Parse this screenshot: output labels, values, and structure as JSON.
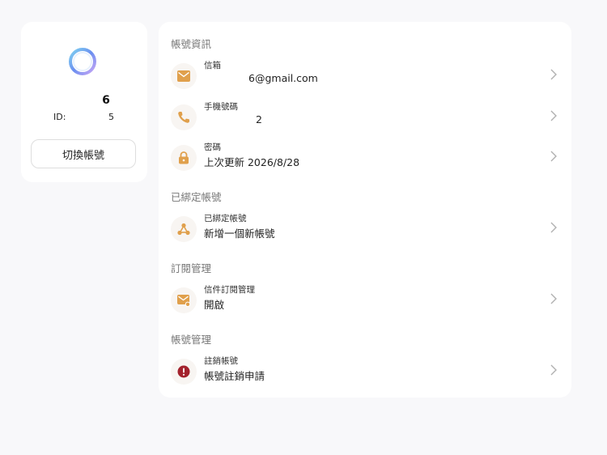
{
  "profile": {
    "name": "6",
    "id_label": "ID:",
    "id_value": "5",
    "switch_label": "切換帳號"
  },
  "colors": {
    "accent": "#e0a04c",
    "danger": "#a3222d",
    "chevron": "#b0b0b0"
  },
  "sections": {
    "account_info": {
      "title": "帳號資訊",
      "email": {
        "label": "信箱",
        "value": "6@gmail.com",
        "icon": "mail-icon"
      },
      "phone": {
        "label": "手機號碼",
        "value": "2",
        "icon": "phone-icon"
      },
      "password": {
        "label": "密碼",
        "value": "上次更新 2026/8/28",
        "icon": "lock-icon"
      }
    },
    "linked_accounts": {
      "title": "已綁定帳號",
      "linked": {
        "label": "已綁定帳號",
        "value": "新增一個新帳號",
        "icon": "share-nodes-icon"
      }
    },
    "subscription": {
      "title": "訂閱管理",
      "mail_sub": {
        "label": "信件訂閱管理",
        "value": "開啟",
        "icon": "mail-settings-icon"
      }
    },
    "account_management": {
      "title": "帳號管理",
      "delete": {
        "label": "註銷帳號",
        "value": "帳號註銷申請",
        "icon": "alert-icon"
      }
    }
  }
}
